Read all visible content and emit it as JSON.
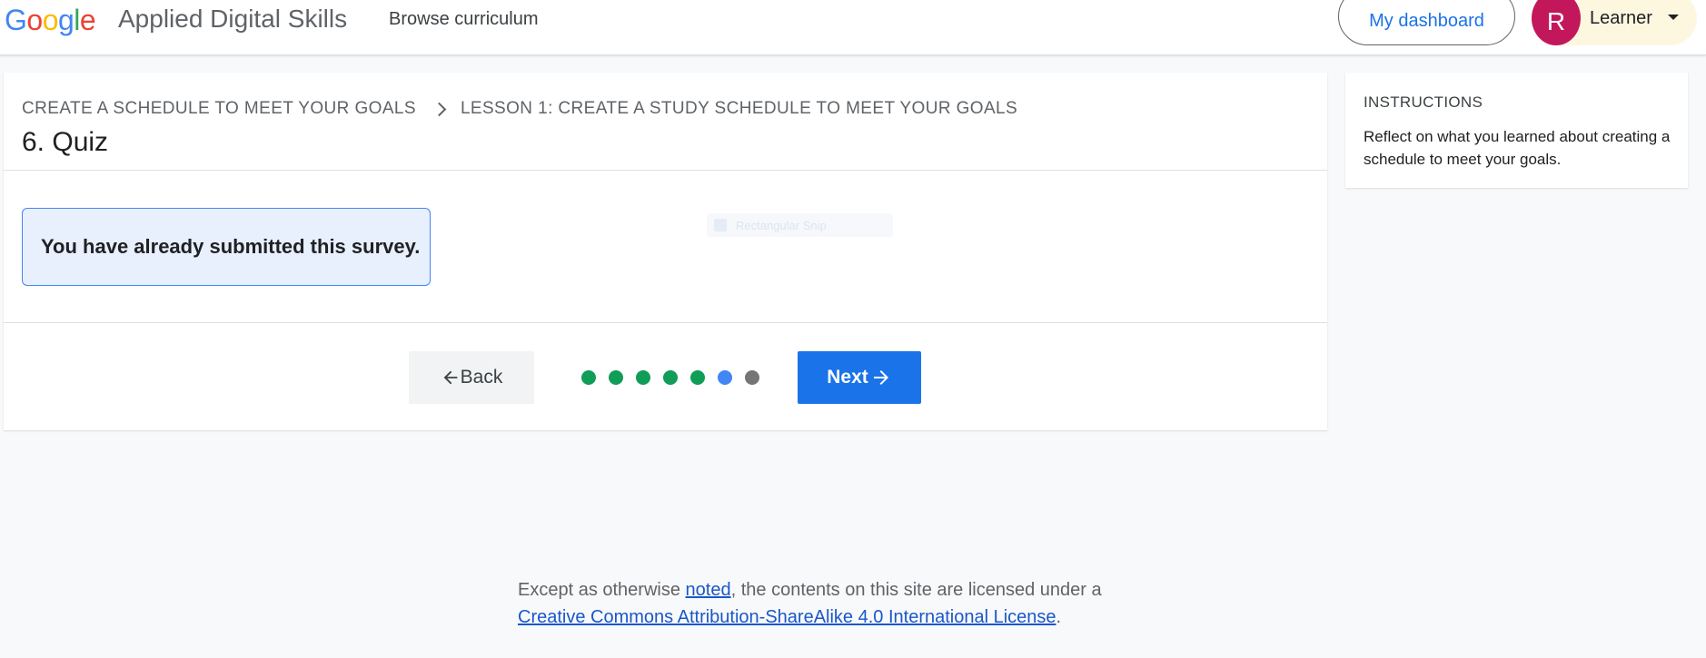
{
  "header": {
    "logo_letters": [
      "G",
      "o",
      "o",
      "g",
      "l",
      "e"
    ],
    "app_title": "Applied Digital Skills",
    "browse_label": "Browse curriculum",
    "dashboard_label": "My dashboard",
    "avatar_initial": "R",
    "user_name": "Learner"
  },
  "lesson": {
    "breadcrumb": [
      "CREATE A SCHEDULE TO MEET YOUR GOALS",
      "LESSON 1: CREATE A STUDY SCHEDULE TO MEET YOUR GOALS"
    ],
    "title": "6. Quiz",
    "notice": "You have already submitted this survey.",
    "ghost_label": "Rectangular Snip"
  },
  "pager": {
    "back_label": "Back",
    "next_label": "Next",
    "steps": [
      "done",
      "done",
      "done",
      "done",
      "done",
      "current",
      "todo"
    ],
    "colors": {
      "done": "#0f9d58",
      "current": "#4285f4",
      "todo": "#757575"
    }
  },
  "instructions": {
    "heading": "INSTRUCTIONS",
    "text": "Reflect on what you learned about creating a schedule to meet your goals."
  },
  "footer": {
    "prefix": "Except as otherwise ",
    "noted_link": "noted",
    "middle": ", the contents on this site are licensed under a",
    "license_link": "Creative Commons Attribution-ShareAlike 4.0 International License",
    "suffix": "."
  }
}
